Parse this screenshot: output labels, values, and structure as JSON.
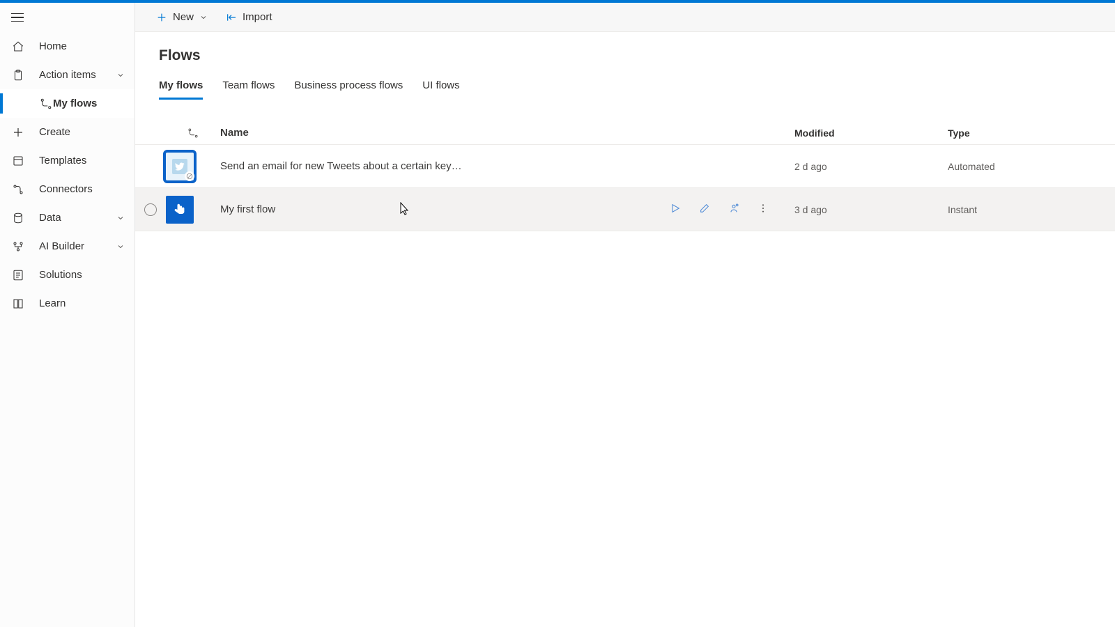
{
  "commandbar": {
    "new_label": "New",
    "import_label": "Import"
  },
  "page_title": "Flows",
  "sidebar": {
    "items": [
      {
        "label": "Home"
      },
      {
        "label": "Action items"
      },
      {
        "label": "My flows"
      },
      {
        "label": "Create"
      },
      {
        "label": "Templates"
      },
      {
        "label": "Connectors"
      },
      {
        "label": "Data"
      },
      {
        "label": "AI Builder"
      },
      {
        "label": "Solutions"
      },
      {
        "label": "Learn"
      }
    ]
  },
  "tabs": [
    {
      "label": "My flows"
    },
    {
      "label": "Team flows"
    },
    {
      "label": "Business process flows"
    },
    {
      "label": "UI flows"
    }
  ],
  "columns": {
    "name": "Name",
    "modified": "Modified",
    "type": "Type"
  },
  "flows": [
    {
      "name": "Send an email for new Tweets about a certain key…",
      "modified": "2 d ago",
      "type": "Automated"
    },
    {
      "name": "My first flow",
      "modified": "3 d ago",
      "type": "Instant"
    }
  ]
}
